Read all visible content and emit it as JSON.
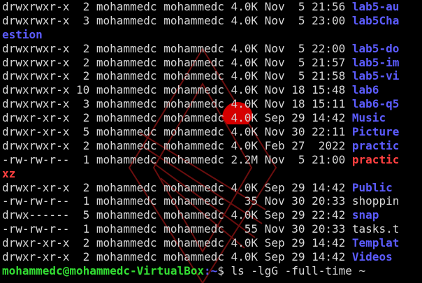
{
  "terminal": {
    "lines": [
      {
        "kind": "entry",
        "meta": "drwxrwxr-x  2 mohammedc mohammedc 4.0K Nov  5 21:56 ",
        "name": "lab5-au",
        "type": "dir"
      },
      {
        "kind": "entry",
        "meta": "drwxrwxr-x  3 mohammedc mohammedc 4.0K Nov  5 23:00 ",
        "name": "lab5Cha",
        "type": "dir"
      },
      {
        "kind": "wrap",
        "name": "estion",
        "type": "dir"
      },
      {
        "kind": "entry",
        "meta": "drwxrwxr-x  2 mohammedc mohammedc 4.0K Nov  5 22:00 ",
        "name": "lab5-do",
        "type": "dir"
      },
      {
        "kind": "entry",
        "meta": "drwxrwxr-x  2 mohammedc mohammedc 4.0K Nov  5 21:57 ",
        "name": "lab5-im",
        "type": "dir"
      },
      {
        "kind": "entry",
        "meta": "drwxrwxr-x  2 mohammedc mohammedc 4.0K Nov  5 21:58 ",
        "name": "lab5-vi",
        "type": "dir"
      },
      {
        "kind": "entry",
        "meta": "drwxrwxr-x 10 mohammedc mohammedc 4.0K Nov 18 15:48 ",
        "name": "lab6",
        "type": "dir"
      },
      {
        "kind": "entry",
        "meta": "drwxrwxr-x  3 mohammedc mohammedc 4.0K Nov 18 15:11 ",
        "name": "lab6-q5",
        "type": "dir"
      },
      {
        "kind": "entry",
        "meta": "drwxr-xr-x  2 mohammedc mohammedc 4.0K Sep 29 14:42 ",
        "name": "Music",
        "type": "dir"
      },
      {
        "kind": "entry",
        "meta": "drwxr-xr-x  5 mohammedc mohammedc 4.0K Nov 30 22:11 ",
        "name": "Picture",
        "type": "dir"
      },
      {
        "kind": "entry",
        "meta": "drwxrwxr-x  2 mohammedc mohammedc 4.0K Feb 27  2022 ",
        "name": "practic",
        "type": "dir"
      },
      {
        "kind": "entry",
        "meta": "-rw-rw-r--  1 mohammedc mohammedc 2.2M Nov  5 21:00 ",
        "name": "practic",
        "type": "archive"
      },
      {
        "kind": "wrap",
        "name": "xz",
        "type": "archive"
      },
      {
        "kind": "entry",
        "meta": "drwxr-xr-x  2 mohammedc mohammedc 4.0K Sep 29 14:42 ",
        "name": "Public",
        "type": "dir"
      },
      {
        "kind": "entry",
        "meta": "-rw-rw-r--  1 mohammedc mohammedc   35 Nov 30 20:33 ",
        "name": "shoppin",
        "type": "plain"
      },
      {
        "kind": "entry",
        "meta": "drwx------  5 mohammedc mohammedc 4.0K Sep 29 22:42 ",
        "name": "snap",
        "type": "dir"
      },
      {
        "kind": "entry",
        "meta": "-rw-rw-r--  1 mohammedc mohammedc   55 Nov 30 20:33 ",
        "name": "tasks.t",
        "type": "plain"
      },
      {
        "kind": "entry",
        "meta": "drwxr-xr-x  2 mohammedc mohammedc 4.0K Sep 29 14:42 ",
        "name": "Templat",
        "type": "dir"
      },
      {
        "kind": "entry",
        "meta": "drwxr-xr-x  2 mohammedc mohammedc 4.0K Sep 29 14:42 ",
        "name": "Videos",
        "type": "dir"
      },
      {
        "kind": "prompt",
        "user": "mohammedc@mohammedc-VirtualBox",
        "path": ":~",
        "command": "$ ls -lgG -full-time ~"
      }
    ]
  },
  "colors": {
    "background": "#000000",
    "text": "#d7d7d7",
    "directory": "#5c5cff",
    "archive": "#ff4040",
    "prompt_user": "#33dd33",
    "watermark": "#c41a1a"
  }
}
